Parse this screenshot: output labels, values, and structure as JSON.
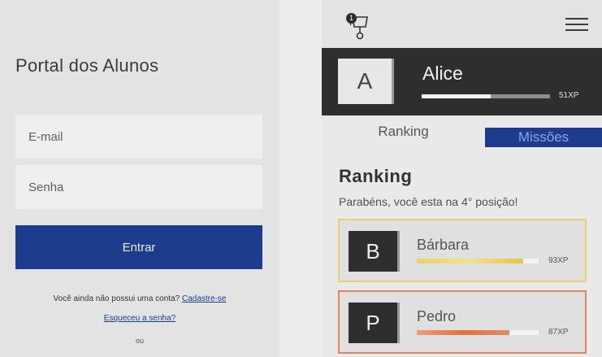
{
  "login": {
    "title": "Portal dos Alunos",
    "email_placeholder": "E-mail",
    "password_placeholder": "Senha",
    "submit_label": "Entrar",
    "no_account_text": "Você ainda não possui uma conta?",
    "signup_link": "Cadastre-se",
    "forgot_link": "Esqueceu a senha?",
    "or_text": "ou"
  },
  "app": {
    "notification_count": "1",
    "trophy_icon": "trophy-icon",
    "menu_icon": "hamburger-menu-icon",
    "user": {
      "avatar_letter": "A",
      "name": "Alice",
      "xp_label": "51XP",
      "xp_progress": 0.54
    },
    "tabs": [
      {
        "label": "Ranking",
        "active": true
      },
      {
        "label": "Missões",
        "active": false
      }
    ],
    "ranking": {
      "heading": "Ranking",
      "message": "Parabéns, você esta na 4° posição!",
      "entries": [
        {
          "letter": "B",
          "name": "Bárbara",
          "xp_label": "93XP",
          "progress": 0.87,
          "color": "#e8d36a"
        },
        {
          "letter": "P",
          "name": "Pedro",
          "xp_label": "87XP",
          "progress": 0.76,
          "color": "#e2865a"
        }
      ]
    }
  },
  "colors": {
    "primary": "#1d3c8e",
    "dark": "#2e2e2e",
    "gold": "#e8d36a",
    "bronze": "#e2865a"
  }
}
